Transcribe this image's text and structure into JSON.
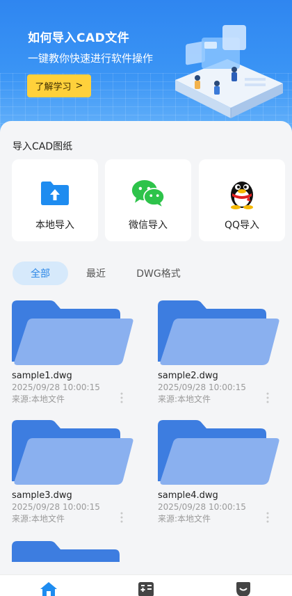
{
  "banner": {
    "title": "如何导入CAD文件",
    "subtitle": "一键教你快速进行软件操作",
    "button_label": "了解学习",
    "button_arrow": ">"
  },
  "import_section": {
    "title": "导入CAD图纸",
    "options": [
      {
        "label": "本地导入",
        "icon": "upload-folder-icon"
      },
      {
        "label": "微信导入",
        "icon": "wechat-icon"
      },
      {
        "label": "QQ导入",
        "icon": "qq-penguin-icon"
      }
    ]
  },
  "tabs": [
    {
      "label": "全部",
      "active": true
    },
    {
      "label": "最近",
      "active": false
    },
    {
      "label": "DWG格式",
      "active": false
    }
  ],
  "files": [
    {
      "name": "sample1.dwg",
      "time": "2025/09/28 10:00:15",
      "source": "来源:本地文件"
    },
    {
      "name": "sample2.dwg",
      "time": "2025/09/28 10:00:15",
      "source": "来源:本地文件"
    },
    {
      "name": "sample3.dwg",
      "time": "2025/09/28 10:00:15",
      "source": "来源:本地文件"
    },
    {
      "name": "sample4.dwg",
      "time": "2025/09/28 10:00:15",
      "source": "来源:本地文件"
    }
  ],
  "nav": [
    {
      "icon": "home-icon",
      "active": true
    },
    {
      "icon": "tools-icon",
      "active": false
    },
    {
      "icon": "profile-icon",
      "active": false
    }
  ],
  "colors": {
    "primary": "#2f86f0",
    "button_yellow": "#ffd13b",
    "folder_blue": "#4a7fe0",
    "active_tab_bg": "#d6e9fb"
  }
}
